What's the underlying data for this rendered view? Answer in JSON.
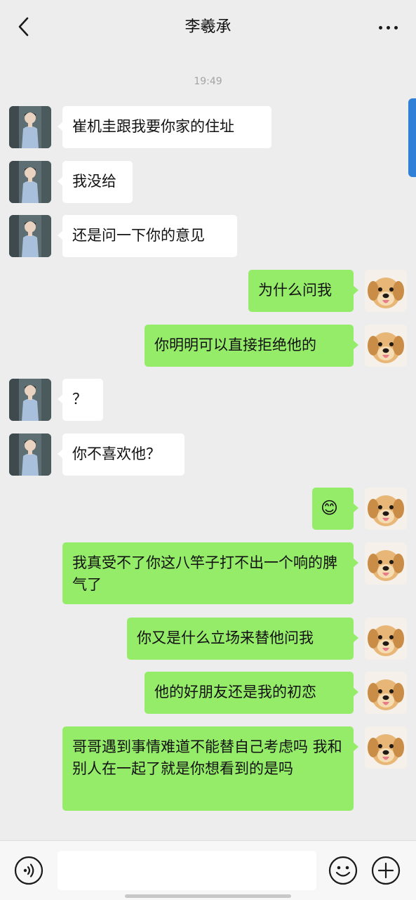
{
  "header": {
    "title": "李羲承"
  },
  "timestamp": "19:49",
  "messages": [
    {
      "side": "left",
      "text": "崔机圭跟我要你家的住址"
    },
    {
      "side": "left",
      "text": "我没给"
    },
    {
      "side": "left",
      "text": "还是问一下你的意见"
    },
    {
      "side": "right",
      "text": "为什么问我"
    },
    {
      "side": "right",
      "text": "你明明可以直接拒绝他的"
    },
    {
      "side": "left",
      "text": "？"
    },
    {
      "side": "left",
      "text": "你不喜欢他？"
    },
    {
      "side": "right",
      "text": "😊"
    },
    {
      "side": "right",
      "text": "我真受不了你这八竿子打不出一个响的脾气了"
    },
    {
      "side": "right",
      "text": "你又是什么立场来替他问我"
    },
    {
      "side": "right",
      "text": "他的好朋友还是我的初恋"
    },
    {
      "side": "right",
      "text": "哥哥遇到事情难道不能替自己考虑吗 我和别人在一起了就是你想看到的是吗"
    }
  ],
  "colors": {
    "background": "#ededed",
    "left_bubble": "#ffffff",
    "right_bubble": "#95ec69",
    "accent_tab": "#2f80d6"
  },
  "icons": {
    "back": "chevron-left-icon",
    "more": "more-dots-icon",
    "voice": "voice-icon",
    "emoji": "emoji-icon",
    "plus": "plus-icon"
  }
}
